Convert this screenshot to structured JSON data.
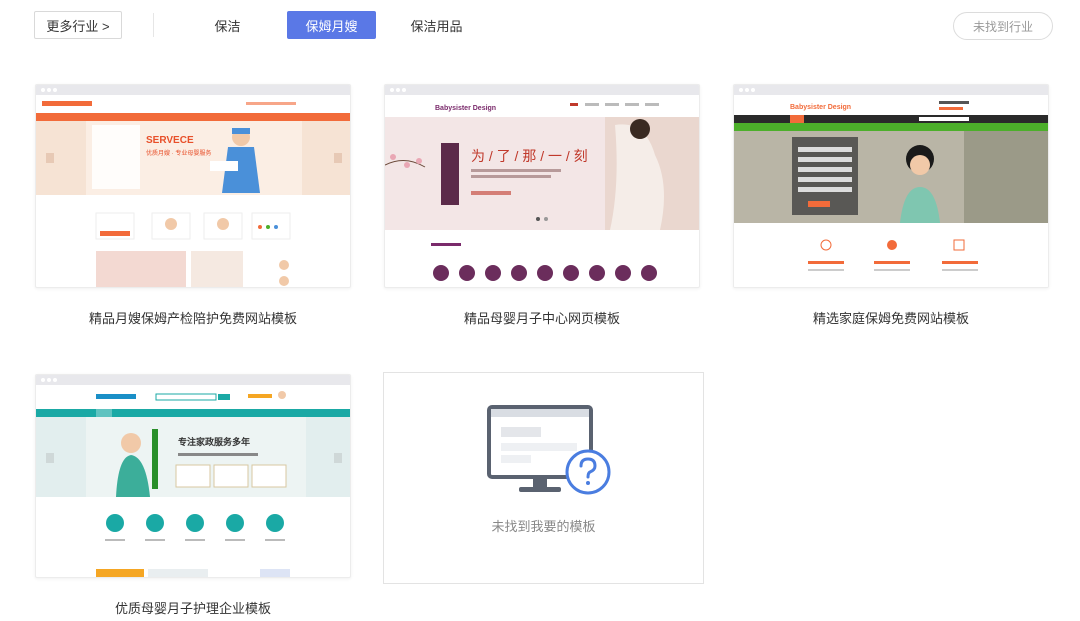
{
  "filter": {
    "more_label": "更多行业 >",
    "tabs": [
      {
        "label": "保洁",
        "active": false
      },
      {
        "label": "保姆月嫂",
        "active": true
      },
      {
        "label": "保洁用品",
        "active": false
      }
    ],
    "not_found_label": "未找到行业"
  },
  "colors": {
    "accent": "#5a78e6",
    "orange": "#f26b3a",
    "green": "#4caf2a",
    "teal": "#19a9a5",
    "purple": "#6b2d5c"
  },
  "templates": [
    {
      "title": "精品月嫂保姆产检陪护免费网站模板",
      "thumb": {
        "hero_en": "SERVECE",
        "hero_cn": "优质月嫂 · 专业母婴服务"
      }
    },
    {
      "title": "精品母婴月子中心网页模板",
      "thumb": {
        "logo": "Babysister Design",
        "hero_cn": "为 / 了 / 那 / 一 / 刻"
      }
    },
    {
      "title": "精选家庭保姆免费网站模板",
      "thumb": {
        "logo": "Babysister Design"
      }
    },
    {
      "title": "优质母婴月子护理企业模板",
      "thumb": {
        "hero_cn": "专注家政服务多年"
      }
    }
  ],
  "empty_card": {
    "label": "未找到我要的模板",
    "icon": "monitor-question-icon"
  }
}
